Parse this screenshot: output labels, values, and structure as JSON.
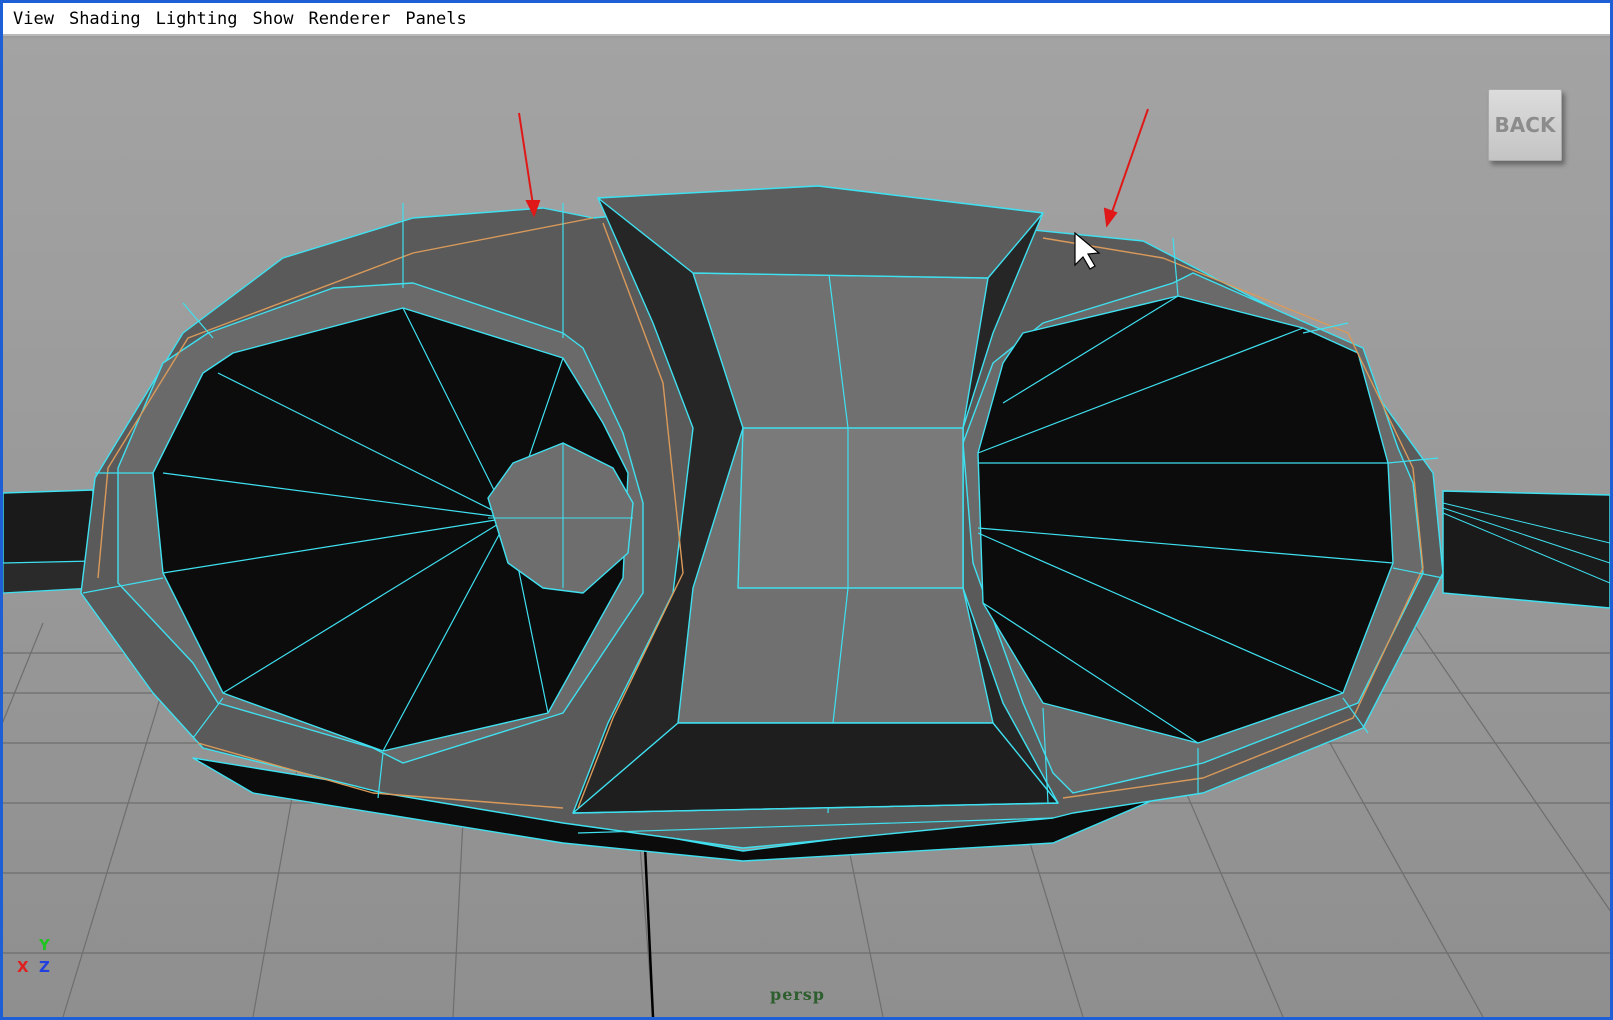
{
  "menu": {
    "items": [
      "View",
      "Shading",
      "Lighting",
      "Show",
      "Renderer",
      "Panels"
    ]
  },
  "viewport": {
    "back_label": "BACK",
    "camera_label": "persp",
    "axes": {
      "y": "Y",
      "x": "X",
      "z": "Z"
    }
  },
  "colors": {
    "frame_border": "#1e5fd6",
    "viewport_bg": "#9d9d9d",
    "wire_selected": "#3fe0f0",
    "edge_loop_highlight": "#d99a5a",
    "annotation_arrow": "#e01818"
  },
  "icons": [
    "mouse-cursor-icon",
    "annotation-arrow-icon"
  ]
}
